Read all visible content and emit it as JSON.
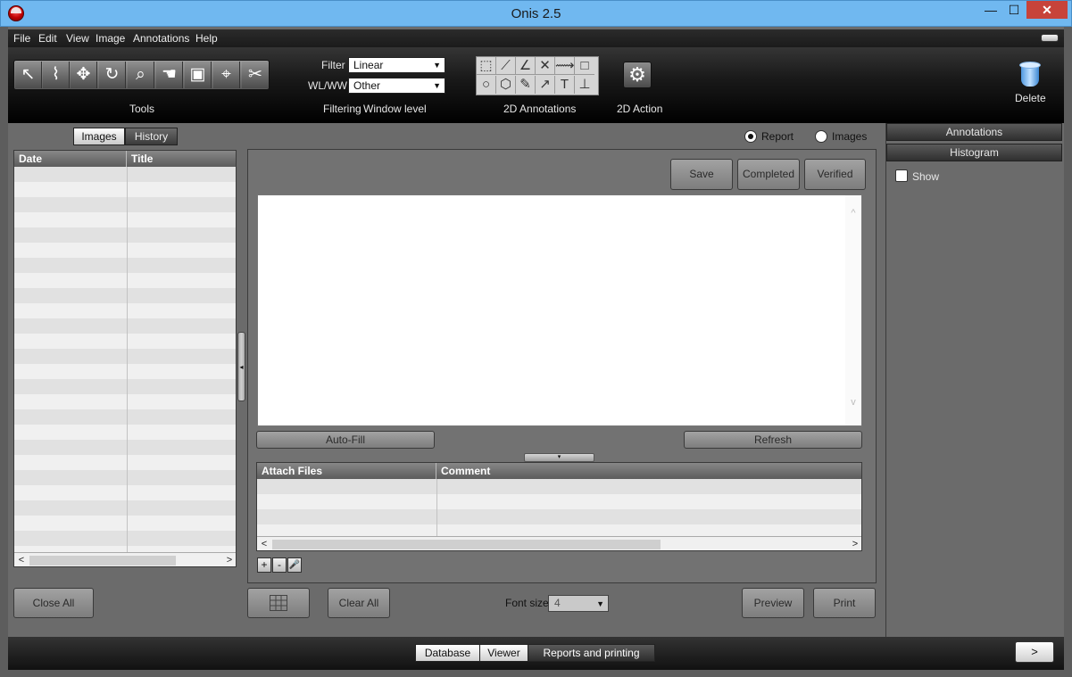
{
  "window": {
    "title": "Onis 2.5",
    "min": "—",
    "max": "☐",
    "close": "✕"
  },
  "menu": [
    "File",
    "Edit",
    "View",
    "Image",
    "Annotations",
    "Help"
  ],
  "toolbar": {
    "tools_label": "Tools",
    "tools": [
      {
        "icon": "pointer-icon",
        "glyph": "↖"
      },
      {
        "icon": "curve-icon",
        "glyph": "⌇"
      },
      {
        "icon": "pan-icon",
        "glyph": "✥"
      },
      {
        "icon": "rotate-icon",
        "glyph": "↻"
      },
      {
        "icon": "zoom-icon",
        "glyph": "⌕"
      },
      {
        "icon": "hand-icon",
        "glyph": "☚"
      },
      {
        "icon": "window-icon",
        "glyph": "▣"
      },
      {
        "icon": "crosshair-icon",
        "glyph": "⌖"
      },
      {
        "icon": "scissors-icon",
        "glyph": "✂"
      }
    ],
    "filter_label": "Filter",
    "filter_value": "Linear",
    "wlww_label": "WL/WW",
    "wlww_value": "Other",
    "filtering_label": "Filtering",
    "window_level_label": "Window level",
    "annotations_label": "2D Annotations",
    "annotation_tools": [
      {
        "icon": "rect-select-icon",
        "glyph": "⬚"
      },
      {
        "icon": "ruler-icon",
        "glyph": "⟋"
      },
      {
        "icon": "angle-icon",
        "glyph": "∠"
      },
      {
        "icon": "cross-angle-icon",
        "glyph": "✕"
      },
      {
        "icon": "polyline-icon",
        "glyph": "⟿"
      },
      {
        "icon": "rectangle-icon",
        "glyph": "□"
      },
      {
        "icon": "ellipse-icon",
        "glyph": "○"
      },
      {
        "icon": "polygon-icon",
        "glyph": "⬡"
      },
      {
        "icon": "pen-icon",
        "glyph": "✎"
      },
      {
        "icon": "arrow-icon",
        "glyph": "↗"
      },
      {
        "icon": "text-icon",
        "glyph": "T"
      },
      {
        "icon": "perpendicular-icon",
        "glyph": "⊥"
      }
    ],
    "action_label": "2D Action",
    "action_glyph": "⚙",
    "delete_label": "Delete"
  },
  "left": {
    "tabs": [
      "Images",
      "History"
    ],
    "columns": [
      "Date",
      "Title"
    ],
    "close_all": "Close All",
    "splitter_glyph": "◂"
  },
  "center": {
    "radio_report": "Report",
    "radio_images": "Images",
    "save": "Save",
    "completed": "Completed",
    "verified": "Verified",
    "report_text": "",
    "scroll_up": "^",
    "scroll_down": "v",
    "autofill": "Auto-Fill",
    "refresh": "Refresh",
    "expander_glyph": "▾",
    "attach_columns": [
      "Attach Files",
      "Comment"
    ],
    "add": "+",
    "remove": "-",
    "mic": "🎤",
    "clear_all": "Clear All",
    "font_size_label": "Font size",
    "font_size_value": "4",
    "preview": "Preview",
    "print": "Print",
    "scroll_left": "<",
    "scroll_right": ">"
  },
  "right": {
    "annotations": "Annotations",
    "histogram": "Histogram",
    "show": "Show"
  },
  "nav": {
    "tabs": [
      "Database",
      "Viewer",
      "Reports and printing"
    ],
    "active": "Reports and printing",
    "next": ">"
  }
}
